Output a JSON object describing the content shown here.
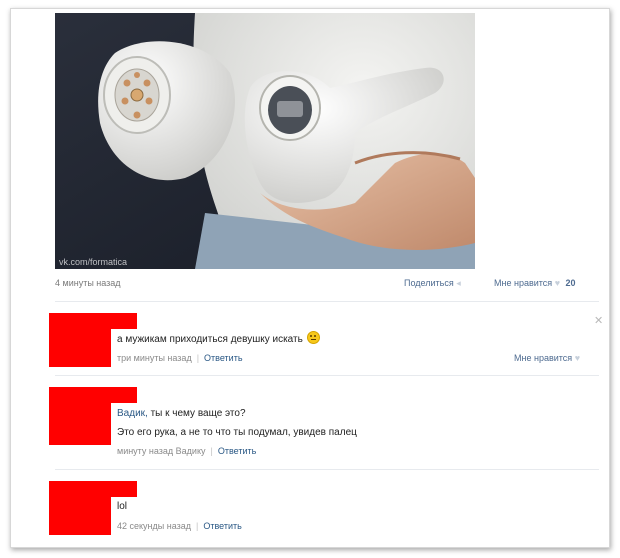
{
  "post": {
    "watermark": "vk.com/formatica",
    "time": "4 минуты назад",
    "share_label": "Поделиться",
    "like_label": "Мне нравится",
    "like_count": "20"
  },
  "comments": [
    {
      "name": "",
      "text": "а мужикам приходиться девушку искать",
      "meta": "три минуты назад",
      "reply": "Ответить",
      "like_label": "Мне нравится"
    },
    {
      "name": "Вадик,",
      "text": " ты к чему ваще это?",
      "text2": "Это его рука, а не то что ты подумал, увидев палец",
      "meta": "минуту назад Вадику",
      "reply": "Ответить"
    },
    {
      "text": "lol",
      "meta": "42 секунды назад",
      "reply": "Ответить"
    }
  ],
  "colors": {
    "avatar_mask": "#ff0000",
    "link": "#2a5885"
  },
  "icons": [
    "heart-icon",
    "close-icon",
    "share-icon",
    "smiley-icon"
  ]
}
